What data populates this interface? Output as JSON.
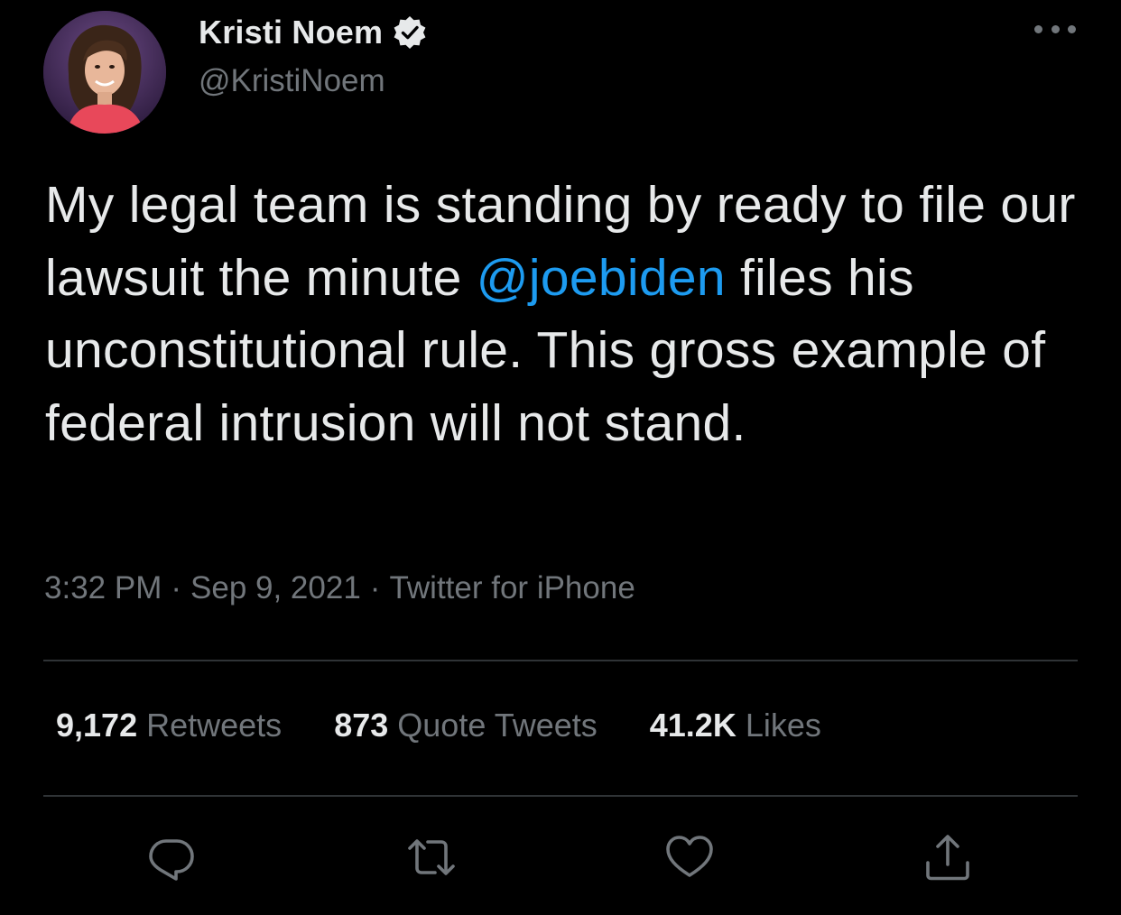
{
  "author": {
    "name": "Kristi Noem",
    "handle": "@KristiNoem",
    "verified": true,
    "avatar_icon": "profile-photo"
  },
  "tweet": {
    "text_before": "My legal team is standing by ready to file our lawsuit the minute ",
    "mention": "@joebiden",
    "text_after": " files his unconstitutional rule. This gross example of federal intrusion will not stand."
  },
  "meta": {
    "time": "3:32 PM",
    "date": "Sep 9, 2021",
    "source": "Twitter for iPhone",
    "separator": "·"
  },
  "stats": {
    "retweets_count": "9,172",
    "retweets_label": "Retweets",
    "quotes_count": "873",
    "quotes_label": "Quote Tweets",
    "likes_count": "41.2K",
    "likes_label": "Likes"
  },
  "actions": [
    {
      "name": "reply",
      "icon": "reply-icon"
    },
    {
      "name": "retweet",
      "icon": "retweet-icon"
    },
    {
      "name": "like",
      "icon": "heart-icon"
    },
    {
      "name": "share",
      "icon": "share-icon"
    }
  ],
  "colors": {
    "background": "#000000",
    "text": "#e7e9ea",
    "secondary": "#71767b",
    "accent": "#1d9bf0",
    "divider": "#2f3336"
  }
}
